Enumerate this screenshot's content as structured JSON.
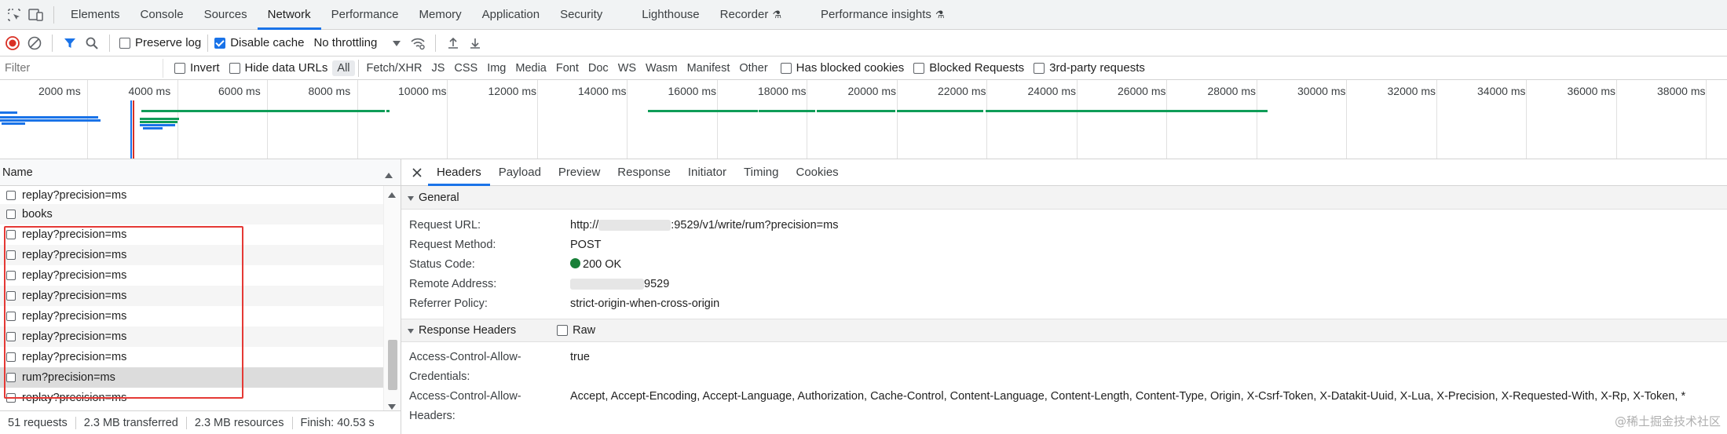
{
  "tabs": [
    "Elements",
    "Console",
    "Sources",
    "Network",
    "Performance",
    "Memory",
    "Application",
    "Security",
    "Lighthouse",
    "Recorder",
    "Performance insights"
  ],
  "active_tab": "Network",
  "toolbar": {
    "preserve_log": "Preserve log",
    "disable_cache": "Disable cache",
    "throttling": "No throttling"
  },
  "filter": {
    "placeholder": "Filter",
    "invert": "Invert",
    "hide_data_urls": "Hide data URLs",
    "types": [
      "All",
      "Fetch/XHR",
      "JS",
      "CSS",
      "Img",
      "Media",
      "Font",
      "Doc",
      "WS",
      "Wasm",
      "Manifest",
      "Other"
    ],
    "has_blocked_cookies": "Has blocked cookies",
    "blocked_requests": "Blocked Requests",
    "third_party": "3rd-party requests"
  },
  "timeline_ticks": [
    "2000 ms",
    "4000 ms",
    "6000 ms",
    "8000 ms",
    "10000 ms",
    "12000 ms",
    "14000 ms",
    "16000 ms",
    "18000 ms",
    "20000 ms",
    "22000 ms",
    "24000 ms",
    "26000 ms",
    "28000 ms",
    "30000 ms",
    "32000 ms",
    "34000 ms",
    "36000 ms",
    "38000 ms"
  ],
  "colors": {
    "accent": "#1a73e8",
    "green": "#0f9d58",
    "blue": "#1a73e8",
    "red_outline": "#e53935",
    "status_ok": "#188038"
  },
  "request_list": {
    "header": "Name",
    "rows": [
      "replay?precision=ms",
      "books",
      "replay?precision=ms",
      "replay?precision=ms",
      "replay?precision=ms",
      "replay?precision=ms",
      "replay?precision=ms",
      "replay?precision=ms",
      "replay?precision=ms",
      "rum?precision=ms",
      "replay?precision=ms"
    ]
  },
  "status": {
    "requests": "51 requests",
    "transferred": "2.3 MB transferred",
    "resources": "2.3 MB resources",
    "finish": "Finish: 40.53 s"
  },
  "detail_tabs": [
    "Headers",
    "Payload",
    "Preview",
    "Response",
    "Initiator",
    "Timing",
    "Cookies"
  ],
  "general": {
    "title": "General",
    "request_url_label": "Request URL:",
    "request_url_prefix": "http://",
    "request_url_suffix": ":9529/v1/write/rum?precision=ms",
    "method_label": "Request Method:",
    "method": "POST",
    "status_label": "Status Code:",
    "status": "200 OK",
    "remote_label": "Remote Address:",
    "remote_suffix": "9529",
    "referrer_label": "Referrer Policy:",
    "referrer": "strict-origin-when-cross-origin"
  },
  "response_headers": {
    "title": "Response Headers",
    "raw": "Raw",
    "acac_label_1": "Access-Control-Allow-",
    "acac_label_2": "Credentials:",
    "acac_value": "true",
    "acah_label_1": "Access-Control-Allow-",
    "acah_label_2": "Headers:",
    "acah_value": "Accept, Accept-Encoding, Accept-Language, Authorization, Cache-Control, Content-Language, Content-Length, Content-Type, Origin, X-Csrf-Token, X-Datakit-Uuid, X-Lua, X-Precision, X-Requested-With, X-Rp, X-Token, *"
  },
  "watermark": "@稀土掘金技术社区"
}
